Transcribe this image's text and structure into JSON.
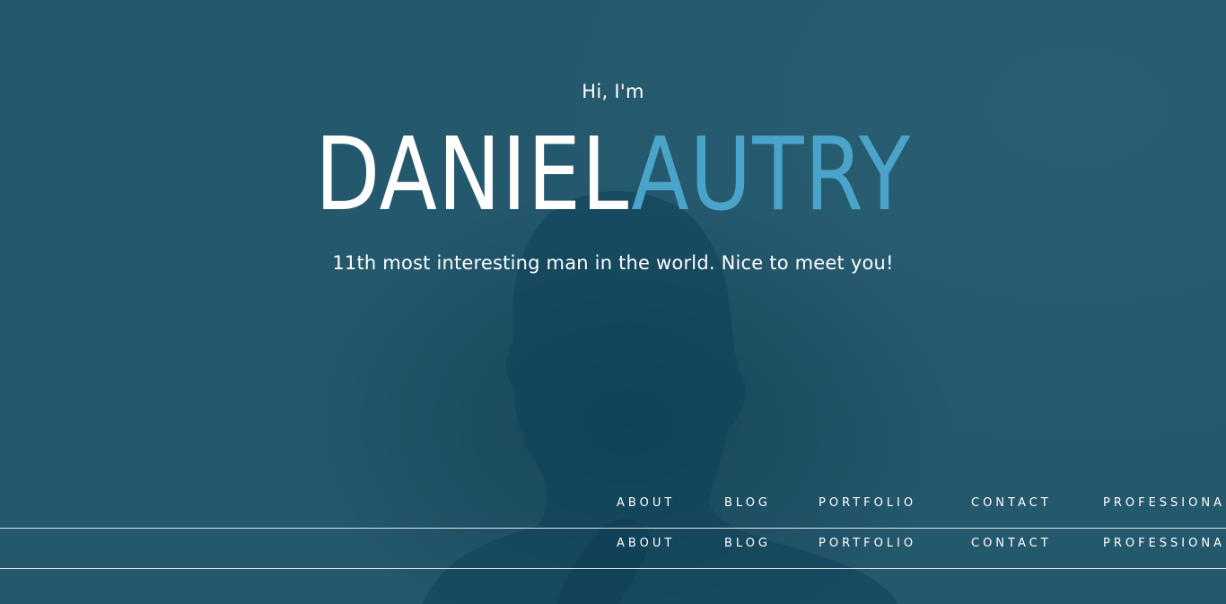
{
  "hero": {
    "greeting": "Hi, I'm",
    "first_name": "DANIEL",
    "last_name": "AUTRY",
    "tagline": "11th most interesting man in the world. Nice to meet you!"
  },
  "nav_primary": {
    "about": "ABOUT",
    "blog": "BLOG",
    "portfolio": "PORTFOLIO",
    "contact": "CONTACT",
    "professional": "PROFESSIONAL"
  },
  "nav_secondary": {
    "about": "ABOUT",
    "blog": "BLOG",
    "portfolio": "PORTFOLIO",
    "contact": "CONTACT",
    "professional": "PROFESSIONAL"
  },
  "colors": {
    "background": "#24586c",
    "accent": "#4aa3c8",
    "text": "#ffffff"
  },
  "background_image": "portrait-photo-overlay"
}
